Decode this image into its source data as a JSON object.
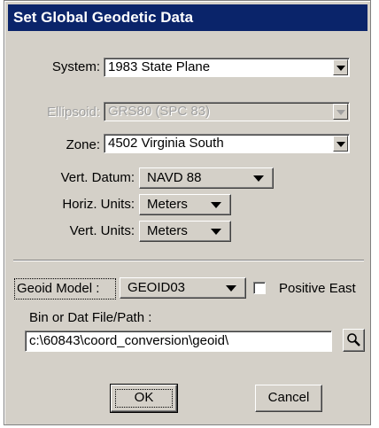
{
  "dialog": {
    "title": "Set Global Geodetic Data"
  },
  "fields": {
    "system": {
      "label": "System:",
      "value": "1983 State Plane"
    },
    "ellipsoid": {
      "label": "Ellipsoid:",
      "value": "GRS80 (SPC 83)",
      "disabled": true
    },
    "zone": {
      "label": "Zone:",
      "value": "4502 Virginia South"
    },
    "vert_datum": {
      "label": "Vert. Datum:",
      "value": "NAVD 88"
    },
    "horiz_units": {
      "label": "Horiz. Units:",
      "value": "Meters"
    },
    "vert_units": {
      "label": "Vert. Units:",
      "value": "Meters"
    },
    "geoid_model": {
      "label": "Geoid Model :",
      "value": "GEOID03"
    },
    "positive_east": {
      "label": "Positive East",
      "checked": false
    },
    "file_path": {
      "label": "Bin or Dat File/Path :",
      "value": "c:\\60843\\coord_conversion\\geoid\\"
    }
  },
  "icons": {
    "browse": "magnifier-icon",
    "dropdown": "triangle-down-icon"
  },
  "buttons": {
    "ok": "OK",
    "cancel": "Cancel"
  },
  "colors": {
    "title_bar": "#0a246a",
    "face": "#d4d0c8",
    "disabled_text": "#a0a0a0"
  }
}
